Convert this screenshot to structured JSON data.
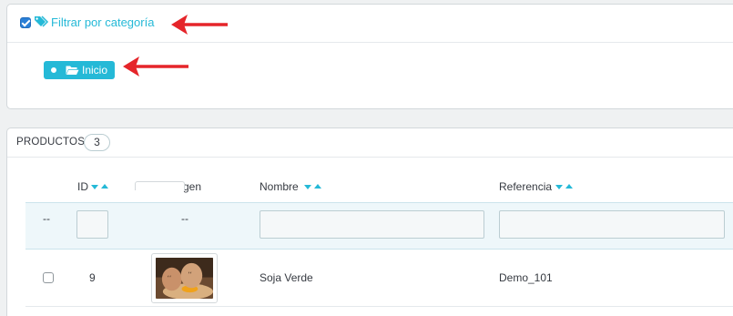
{
  "filter": {
    "label": "Filtrar por categoría",
    "checked": true,
    "tree_root": "Inicio"
  },
  "products": {
    "title": "PRODUCTOS",
    "count": "3",
    "columns": [
      "ID",
      "Imagen",
      "Nombre",
      "Referencia"
    ],
    "filter_placeholder_dash": "--",
    "rows": [
      {
        "id": "9",
        "name": "Soja Verde",
        "reference": "Demo_101",
        "checked": false
      }
    ]
  },
  "colors": {
    "accent": "#25b9d7",
    "checkbox": "#2a7fd6",
    "annotation_arrow": "#e5252a"
  },
  "icons": [
    "tags-icon",
    "folder-open-icon",
    "sort-desc-icon",
    "sort-asc-icon"
  ]
}
